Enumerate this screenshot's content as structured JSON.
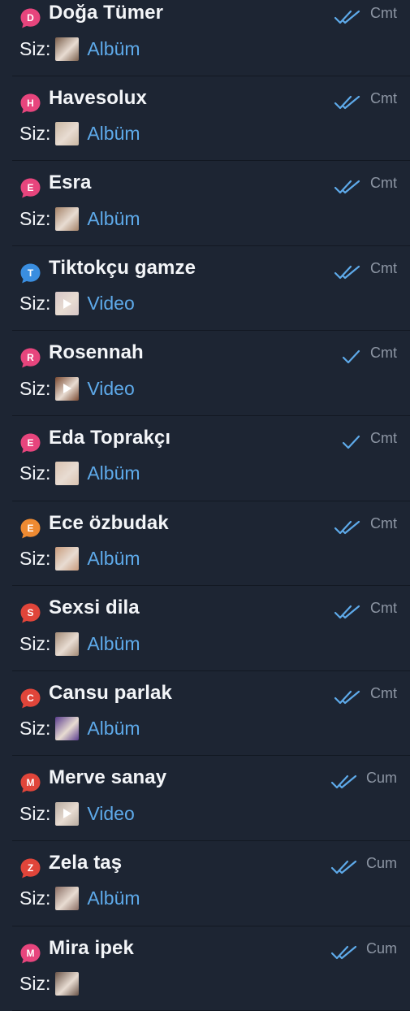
{
  "chats": [
    {
      "initial": "D",
      "avatar_color": "#e7457d",
      "avatar_icon": "chat-bubble-avatar-icon",
      "name": "Doğa Tümer",
      "status": "read",
      "time": "Cmt",
      "prefix": "Siz:",
      "media": "Albüm",
      "media_type": "album",
      "thumb": "#7a5f4c"
    },
    {
      "initial": "H",
      "avatar_color": "#e7457d",
      "avatar_icon": "chat-bubble-avatar-icon",
      "name": "Havesolux",
      "status": "read",
      "time": "Cmt",
      "prefix": "Siz:",
      "media": "Albüm",
      "media_type": "album",
      "thumb": "#c9b7a2"
    },
    {
      "initial": "E",
      "avatar_color": "#e7457d",
      "avatar_icon": "chat-bubble-avatar-icon",
      "name": "Esra",
      "status": "read",
      "time": "Cmt",
      "prefix": "Siz:",
      "media": "Albüm",
      "media_type": "album",
      "thumb": "#a48268"
    },
    {
      "initial": "T",
      "avatar_color": "#3a8ee0",
      "avatar_icon": "chat-bubble-avatar-icon",
      "name": "Tiktokçu gamze",
      "status": "read",
      "time": "Cmt",
      "prefix": "Siz:",
      "media": "Video",
      "media_type": "video",
      "thumb": "#d6c6c6"
    },
    {
      "initial": "R",
      "avatar_color": "#e7457d",
      "avatar_icon": "chat-bubble-avatar-icon",
      "name": "Rosennah",
      "status": "sent",
      "time": "Cmt",
      "prefix": "Siz:",
      "media": "Video",
      "media_type": "video",
      "thumb": "#7a4a32"
    },
    {
      "initial": "E",
      "avatar_color": "#e7457d",
      "avatar_icon": "chat-bubble-avatar-icon",
      "name": "Eda Toprakçı",
      "status": "sent",
      "time": "Cmt",
      "prefix": "Siz:",
      "media": "Albüm",
      "media_type": "album",
      "thumb": "#d9c2b0"
    },
    {
      "initial": "E",
      "avatar_color": "#ee8a32",
      "avatar_icon": "chat-bubble-avatar-icon",
      "name": "Ece özbudak",
      "status": "read",
      "time": "Cmt",
      "prefix": "Siz:",
      "media": "Albüm",
      "media_type": "album",
      "thumb": "#c89b7c"
    },
    {
      "initial": "S",
      "avatar_color": "#e0453a",
      "avatar_icon": "chat-bubble-avatar-icon",
      "name": "Sexsi dila",
      "status": "read",
      "time": "Cmt",
      "prefix": "Siz:",
      "media": "Albüm",
      "media_type": "album",
      "thumb": "#a28a76"
    },
    {
      "initial": "C",
      "avatar_color": "#e0453a",
      "avatar_icon": "chat-bubble-avatar-icon",
      "name": "Cansu parlak",
      "status": "read",
      "time": "Cmt",
      "prefix": "Siz:",
      "media": "Albüm",
      "media_type": "album",
      "thumb": "#5b3d8e"
    },
    {
      "initial": "M",
      "avatar_color": "#e0453a",
      "avatar_icon": "chat-bubble-avatar-icon",
      "name": "Merve sanay",
      "status": "read",
      "time": "Cum",
      "prefix": "Siz:",
      "media": "Video",
      "media_type": "video",
      "thumb": "#b9aca0"
    },
    {
      "initial": "Z",
      "avatar_color": "#e0453a",
      "avatar_icon": "chat-bubble-avatar-icon",
      "name": "Zela taş",
      "status": "read",
      "time": "Cum",
      "prefix": "Siz:",
      "media": "Albüm",
      "media_type": "album",
      "thumb": "#8a6e64"
    },
    {
      "initial": "M",
      "avatar_color": "#e7457d",
      "avatar_icon": "chat-bubble-avatar-icon",
      "name": "Mira ipek",
      "status": "read",
      "time": "Cum",
      "prefix": "Siz:",
      "media": "",
      "media_type": "album",
      "thumb": "#6a5448"
    }
  ],
  "colors": {
    "background": "#1d2533",
    "name_text": "#f3f5f8",
    "media_link": "#5eaaea",
    "check_marks": "#5eaaea",
    "time_text": "#8d96a4"
  }
}
